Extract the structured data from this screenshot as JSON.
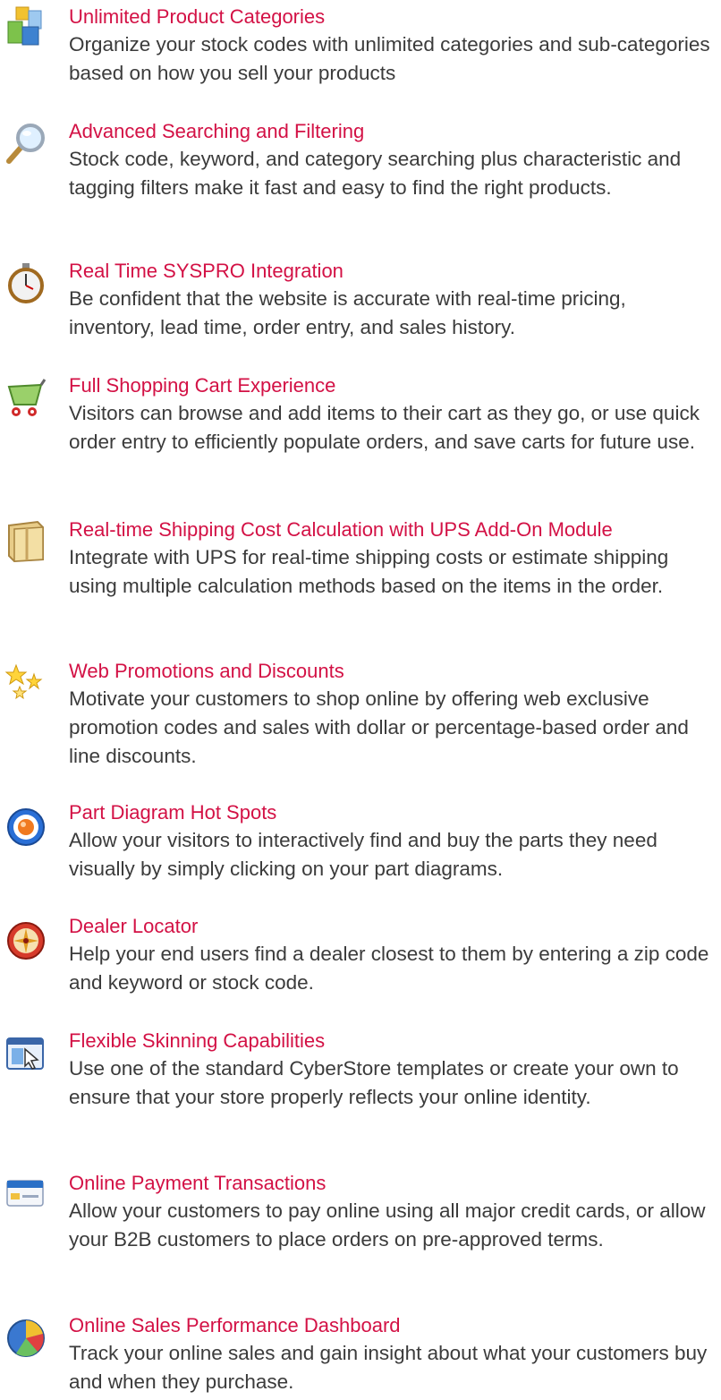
{
  "features": [
    {
      "icon": "product-categories-icon",
      "title": "Unlimited Product Categories",
      "desc": "Organize your stock codes with unlimited categories and sub-categories based on how you sell your products"
    },
    {
      "icon": "magnifier-search-icon",
      "title": "Advanced Searching and Filtering",
      "desc": "Stock code, keyword, and category searching plus characteristic and tagging filters make it fast and easy to find the right products."
    },
    {
      "icon": "stopwatch-icon",
      "title": "Real Time SYSPRO Integration",
      "desc": "Be confident that the website is accurate with real-time pricing, inventory, lead time, order entry, and sales history."
    },
    {
      "icon": "shopping-cart-icon",
      "title": "Full Shopping Cart Experience",
      "desc": "Visitors can browse and add items to their cart as they go, or use quick order entry to efficiently populate orders, and save carts for future use."
    },
    {
      "icon": "shipping-box-icon",
      "title": "Real-time Shipping Cost Calculation with UPS Add-On Module",
      "desc": "Integrate with UPS for real-time shipping costs or estimate shipping using multiple calculation methods based on the items in the order."
    },
    {
      "icon": "sparkle-promotion-icon",
      "title": "Web Promotions and Discounts",
      "desc": "Motivate your customers to shop online by offering web exclusive promotion codes and sales with dollar or percentage-based order and line discounts."
    },
    {
      "icon": "hot-spot-target-icon",
      "title": "Part Diagram Hot Spots",
      "desc": "Allow your visitors to interactively find and buy the parts they need visually by simply clicking on your part diagrams."
    },
    {
      "icon": "compass-locator-icon",
      "title": "Dealer Locator",
      "desc": "Help your end users find a dealer closest to them by entering a zip code and keyword or stock code."
    },
    {
      "icon": "skin-template-icon",
      "title": "Flexible Skinning Capabilities",
      "desc": "Use one of the standard CyberStore templates or create your own to ensure that your store properly reflects your online identity."
    },
    {
      "icon": "credit-card-icon",
      "title": "Online Payment Transactions",
      "desc": "Allow your customers to pay online using all major credit cards, or allow your B2B customers to place orders on pre-approved terms."
    },
    {
      "icon": "pie-chart-dashboard-icon",
      "title": "Online Sales Performance Dashboard",
      "desc": "Track your online sales and gain insight about what your customers buy and when they purchase."
    }
  ]
}
